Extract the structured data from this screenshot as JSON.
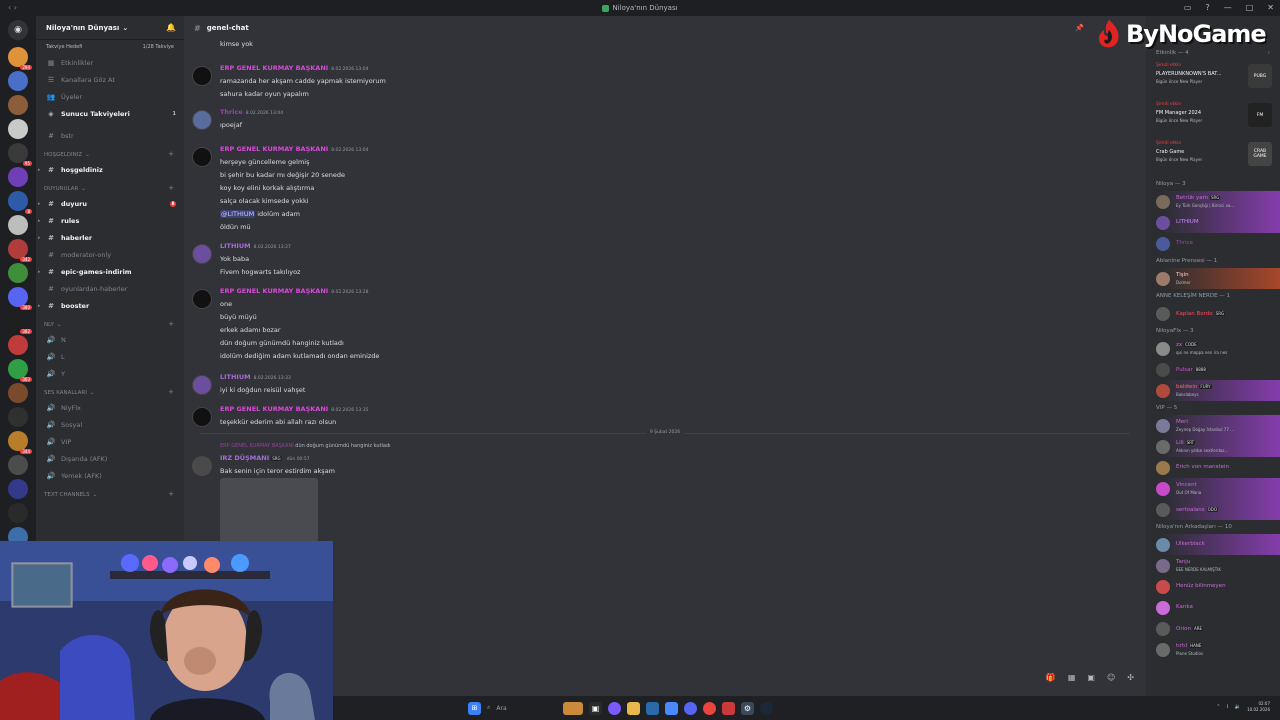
{
  "window": {
    "title": "Niloya'nın Dünyası",
    "controls": [
      "—",
      "□",
      "✕"
    ]
  },
  "watermark": {
    "text": "ByNoGame"
  },
  "guilds": [
    {
      "color": "#e0923b",
      "badge": "294"
    },
    {
      "color": "#4a6fc9",
      "badge": ""
    },
    {
      "color": "#8c5d3b",
      "badge": ""
    },
    {
      "color": "#c9c9c9",
      "badge": ""
    },
    {
      "color": "#3a3a3a",
      "badge": "95"
    },
    {
      "color": "#6f3fb8",
      "badge": ""
    },
    {
      "color": "#2e5ba8",
      "badge": "8"
    },
    {
      "color": "#bdbdbd",
      "badge": ""
    },
    {
      "color": "#b03c3c",
      "badge": "342"
    },
    {
      "color": "#3f8f3a",
      "badge": ""
    },
    {
      "color": "#5865f2",
      "badge": "380"
    },
    {
      "color": "#1f1f1f",
      "badge": "382"
    },
    {
      "color": "#c23b3b",
      "badge": ""
    },
    {
      "color": "#2f9e44",
      "badge": "303"
    },
    {
      "color": "#7a4a2a",
      "badge": ""
    },
    {
      "color": "#303030",
      "badge": ""
    },
    {
      "color": "#b87d2b",
      "badge": "344"
    },
    {
      "color": "#4c4c4c",
      "badge": ""
    },
    {
      "color": "#333a8a",
      "badge": ""
    },
    {
      "color": "#2a2a2a",
      "badge": ""
    },
    {
      "color": "#3d6ea8",
      "badge": ""
    }
  ],
  "sidebar": {
    "server_name": "Niloya'nın Dünyası",
    "boost_goal": "Takviye Hedefi",
    "boost_count": "1/28 Takviye",
    "items": [
      {
        "icon": "calendar",
        "label": "Etkinlikler",
        "bold": false
      },
      {
        "icon": "browse",
        "label": "Kanallara Göz At",
        "bold": false
      },
      {
        "icon": "members",
        "label": "Üyeler",
        "bold": false
      },
      {
        "icon": "boost",
        "label": "Sunucu Takviyeleri",
        "bold": true,
        "right": "1"
      }
    ],
    "channels": [
      {
        "type": "channel",
        "icon": "#",
        "label": "bstr",
        "bold": false
      },
      {
        "type": "category",
        "label": "Hoşgeldiniz"
      },
      {
        "type": "channel",
        "icon": "#",
        "label": "hoşgeldiniz",
        "bold": true
      },
      {
        "type": "category",
        "label": "Duyurular"
      },
      {
        "type": "channel",
        "icon": "#",
        "label": "duyuru",
        "bold": true,
        "dot": "8"
      },
      {
        "type": "channel",
        "icon": "#",
        "label": "rules",
        "bold": true
      },
      {
        "type": "channel",
        "icon": "#",
        "label": "haberler",
        "bold": true
      },
      {
        "type": "channel",
        "icon": "#",
        "label": "moderator-only",
        "bold": false
      },
      {
        "type": "channel",
        "icon": "#",
        "label": "epic-games-indirim",
        "bold": true
      },
      {
        "type": "channel",
        "icon": "#",
        "label": "oyunlardan-haberler",
        "bold": false
      },
      {
        "type": "channel",
        "icon": "#",
        "label": "booster",
        "bold": true
      },
      {
        "type": "category",
        "label": "NLY"
      },
      {
        "type": "channel",
        "icon": "🔊",
        "label": "N",
        "bold": false
      },
      {
        "type": "channel",
        "icon": "🔊",
        "label": "L",
        "bold": false
      },
      {
        "type": "channel",
        "icon": "🔊",
        "label": "Y",
        "bold": false
      },
      {
        "type": "category",
        "label": "Ses Kanalları"
      },
      {
        "type": "channel",
        "icon": "🔊",
        "label": "NiyFlx",
        "bold": false
      },
      {
        "type": "channel",
        "icon": "🔊",
        "label": "Sosyal",
        "bold": false
      },
      {
        "type": "channel",
        "icon": "🔊",
        "label": "VIP",
        "bold": false
      },
      {
        "type": "channel",
        "icon": "🔊",
        "label": "Dışarıda (AFK)",
        "bold": false
      },
      {
        "type": "channel",
        "icon": "🔊",
        "label": "Yemek (AFK)",
        "bold": false
      },
      {
        "type": "category",
        "label": "Text Channels"
      }
    ]
  },
  "chat": {
    "channel_name": "genel-chat",
    "first_line": "kimse yok",
    "messages": [
      {
        "author": "ERP GENEL KURMAY BAŞKANI",
        "color": "#d84ad8",
        "time": "8.02.2026 13:04",
        "avatar": "#111",
        "lines": [
          "ramazanda her akşam cadde yapmak istemiyorum",
          "sahura kadar oyun yapalım"
        ]
      },
      {
        "author": "Thrice",
        "color": "#8f4aa8",
        "time": "8.02.2026 13:04",
        "avatar": "#5a6b9e",
        "lines": [
          "ıpoejaf"
        ]
      },
      {
        "author": "ERP GENEL KURMAY BAŞKANI",
        "color": "#d84ad8",
        "time": "8.02.2026 13:04",
        "avatar": "#111",
        "lines": [
          "herşeye güncelleme gelmiş",
          "bi şehir bu kadar mı değişir 20 senede",
          "koy koy elini korkak alıştırma",
          "salça olacak kimsede yokki",
          "@LITHIUM idolüm adam",
          "öldün mü"
        ]
      },
      {
        "author": "LITHIUM",
        "color": "#a86bd8",
        "time": "8.02.2026 13:27",
        "avatar": "#6b4f9e",
        "lines": [
          "Yok baba",
          "Fivem hogwarts takılıyoz"
        ]
      },
      {
        "author": "ERP GENEL KURMAY BAŞKANI",
        "color": "#d84ad8",
        "time": "8.02.2026 13:28",
        "avatar": "#111",
        "lines": [
          "one",
          "büyü müyü",
          "erkek adamı bozar",
          "dün doğum günümdü hanginiz kutladı",
          "idolüm dediğim adam kutlamadı ondan eminizde"
        ]
      },
      {
        "author": "LITHIUM",
        "color": "#a86bd8",
        "time": "8.02.2026 13:33",
        "avatar": "#6b4f9e",
        "lines": [
          "iyi ki doğdun reisül vahşet"
        ]
      },
      {
        "author": "ERP GENEL KURMAY BAŞKANI",
        "color": "#d84ad8",
        "time": "8.02.2026 13:35",
        "avatar": "#111",
        "lines": [
          "teşekkür ederim abi allah razı olsun"
        ]
      }
    ],
    "mention_text": "@LITHIUM",
    "mention_rest": " idolüm adam",
    "date_divider": "9 Şubat 2026",
    "reply": {
      "quoted_author": "ERP GENEL KURMAY BAŞKANI",
      "quoted_text": "dün doğum günümdü hanginiz kutladı",
      "author": "IRZ DÜŞMANI",
      "tag": "SRG",
      "time": "dün 00:57",
      "text": "Bak senin için teror estirdim akşam"
    }
  },
  "members": {
    "events_header": "Etkinlik — 4",
    "events": [
      {
        "live": "Şimdi etkin",
        "title": "PLAYERUNKNOWN'S BAT...",
        "meta": "Bigün önce   New Player",
        "icon": "PUBG",
        "icon_bg": "#3a3a3a"
      },
      {
        "live": "Şimdi etkin",
        "title": "FM Manager 2024",
        "meta": "Bigün önce   New Player",
        "icon": "FM",
        "icon_bg": "#222"
      },
      {
        "live": "Şimdi etkin",
        "title": "Crab Game",
        "meta": "Bigün önce   New Player",
        "icon": "CRAB GAME",
        "icon_bg": "#444"
      }
    ],
    "groups": [
      {
        "name": "Niloya — 3",
        "members": [
          {
            "name": "Betrük yam",
            "tag": "SRG",
            "status": "Ey Türk Gençliği | Birinci va...",
            "color": "#c96bd8",
            "avatar": "#7a6a5a",
            "style": "hl"
          },
          {
            "name": "LITHIUM",
            "tag": "",
            "status": "",
            "color": "#c98bff",
            "avatar": "#6b4f9e",
            "style": "hl"
          },
          {
            "name": "Thrice",
            "tag": "",
            "status": "",
            "color": "#8f4aa8",
            "avatar": "#4a5a9e",
            "style": ""
          }
        ]
      },
      {
        "name": "Ablanine Prensesi — 1",
        "members": [
          {
            "name": "Tişin",
            "tag": "",
            "status": "Dolmer",
            "color": "#ffd0c0",
            "avatar": "#9e7a6a",
            "style": "red"
          }
        ]
      },
      {
        "name": "ANNE KELEŞİM NERDE — 1",
        "members": [
          {
            "name": "Kaplan Bordo",
            "tag": "SRG",
            "status": "",
            "color": "#ff4a5a",
            "avatar": "#5a5a5a",
            "style": ""
          }
        ]
      },
      {
        "name": "NiloyaFlx — 3",
        "members": [
          {
            "name": "zx",
            "tag": "CODE",
            "status": "qui ne mappa nen ira nes",
            "color": "#c96bd8",
            "avatar": "#8a8a8a",
            "style": ""
          },
          {
            "name": "Pulsar",
            "tag": "8888",
            "status": "",
            "color": "#d84ad8",
            "avatar": "#4a4a4a",
            "style": ""
          },
          {
            "name": "baldwin",
            "tag": "FURY",
            "status": "Bakslaboys",
            "color": "#ff6a4a",
            "avatar": "#b04a3a",
            "style": "hl"
          }
        ]
      },
      {
        "name": "VIP — 5",
        "members": [
          {
            "name": "Meri",
            "tag": "",
            "status": "Zeynep Doğay İstanbul 77 ...",
            "color": "#c96bd8",
            "avatar": "#7a7a9a",
            "style": "hl"
          },
          {
            "name": "Lili",
            "tag": "SRT",
            "status": "Aldının yıldızı sextlerdaz...",
            "color": "#c96bd8",
            "avatar": "#6a6a6a",
            "style": "hl"
          },
          {
            "name": "Erich von manstein",
            "tag": "",
            "status": "",
            "color": "#c96bd8",
            "avatar": "#9a7a4a",
            "style": ""
          },
          {
            "name": "Vincent",
            "tag": "",
            "status": "Out Of Mana",
            "color": "#c96bd8",
            "avatar": "#c94ac9",
            "style": "hl"
          },
          {
            "name": "sertoalans",
            "tag": "ODO",
            "status": "",
            "color": "#c96bd8",
            "avatar": "#5a5a5a",
            "style": "hl"
          }
        ]
      },
      {
        "name": "Niloya'nın Arkadaşları — 10",
        "members": [
          {
            "name": "Ülkerblack",
            "tag": "",
            "status": "",
            "color": "#c96bd8",
            "avatar": "#6a8aaa",
            "style": "hl"
          },
          {
            "name": "Tanju",
            "tag": "",
            "status": "EEE NERDE KALMIŞTIK",
            "color": "#c96bd8",
            "avatar": "#7a6a8a",
            "style": ""
          },
          {
            "name": "Henüz bilinmeyen",
            "tag": "",
            "status": "",
            "color": "#c96bd8",
            "avatar": "#c94a4a",
            "style": ""
          },
          {
            "name": "Kanka",
            "tag": "",
            "status": "",
            "color": "#c96bd8",
            "avatar": "#c96bd8",
            "style": ""
          },
          {
            "name": "Orion",
            "tag": "ARE",
            "status": "",
            "color": "#c96bd8",
            "avatar": "#5a5a5a",
            "style": ""
          },
          {
            "name": "tırtıl",
            "tag": "HANE",
            "status": "Plane Studios",
            "color": "#c96bd8",
            "avatar": "#6a6a6a",
            "style": ""
          }
        ]
      }
    ]
  },
  "taskbar": {
    "search_placeholder": "Ara",
    "clock_time": "02:07",
    "clock_date": "10.02.2026"
  }
}
